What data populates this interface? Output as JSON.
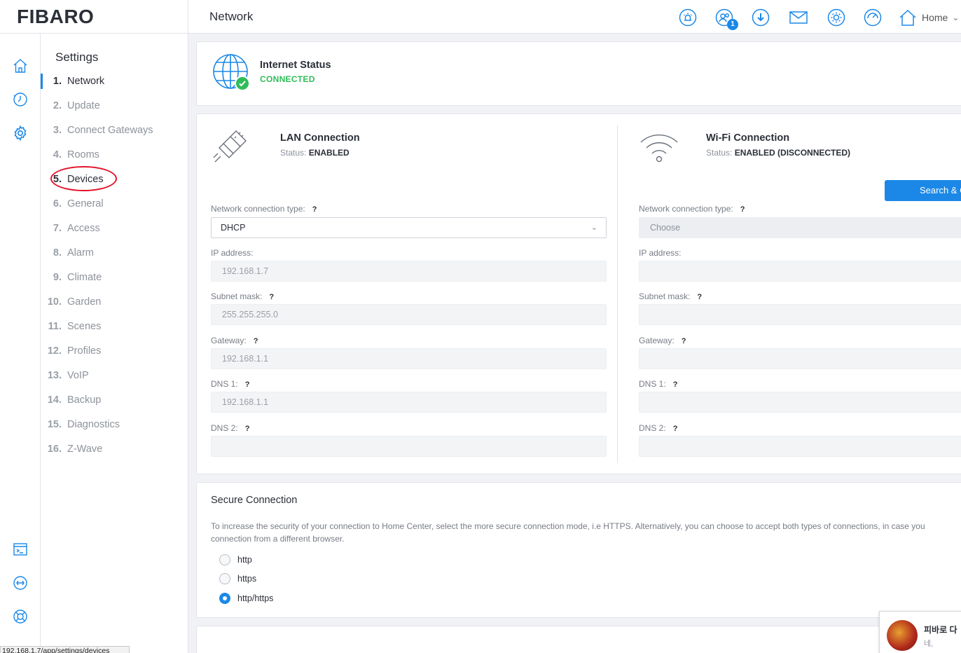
{
  "app": {
    "logo": "FIBARO",
    "page_title": "Network"
  },
  "topbar": {
    "icons": [
      "alarm-icon",
      "users-icon",
      "download-icon",
      "mail-icon",
      "sun-icon",
      "dashboard-icon",
      "home-icon"
    ],
    "users_badge": "1",
    "home_label": "Home",
    "home_chevron": "⌄"
  },
  "rail": {
    "icons": [
      "home-icon",
      "history-icon",
      "settings-icon",
      "terminal-icon",
      "plugin-icon",
      "support-icon"
    ]
  },
  "settings": {
    "title": "Settings",
    "items": [
      {
        "num": "1.",
        "label": "Network"
      },
      {
        "num": "2.",
        "label": "Update"
      },
      {
        "num": "3.",
        "label": "Connect Gateways"
      },
      {
        "num": "4.",
        "label": "Rooms"
      },
      {
        "num": "5.",
        "label": "Devices"
      },
      {
        "num": "6.",
        "label": "General"
      },
      {
        "num": "7.",
        "label": "Access"
      },
      {
        "num": "8.",
        "label": "Alarm"
      },
      {
        "num": "9.",
        "label": "Climate"
      },
      {
        "num": "10.",
        "label": "Garden"
      },
      {
        "num": "11.",
        "label": "Scenes"
      },
      {
        "num": "12.",
        "label": "Profiles"
      },
      {
        "num": "13.",
        "label": "VoIP"
      },
      {
        "num": "14.",
        "label": "Backup"
      },
      {
        "num": "15.",
        "label": "Diagnostics"
      },
      {
        "num": "16.",
        "label": "Z-Wave"
      }
    ],
    "active_index": 0,
    "highlighted_index": 4
  },
  "internet": {
    "title": "Internet Status",
    "status": "CONNECTED"
  },
  "lan": {
    "title": "LAN Connection",
    "status_label": "Status:",
    "status_value": "ENABLED",
    "type_label": "Network connection type:",
    "type_value": "DHCP",
    "ip_label": "IP address:",
    "ip_value": "192.168.1.7",
    "subnet_label": "Subnet mask:",
    "subnet_value": "255.255.255.0",
    "gateway_label": "Gateway:",
    "gateway_value": "192.168.1.1",
    "dns1_label": "DNS 1:",
    "dns1_value": "192.168.1.1",
    "dns2_label": "DNS 2:",
    "dns2_value": ""
  },
  "wifi": {
    "title": "Wi-Fi Connection",
    "status_label": "Status:",
    "status_value": "ENABLED (DISCONNECTED)",
    "search_button": "Search & C",
    "type_label": "Network connection type:",
    "type_value": "Choose",
    "ip_label": "IP address:",
    "subnet_label": "Subnet mask:",
    "gateway_label": "Gateway:",
    "dns1_label": "DNS 1:",
    "dns2_label": "DNS 2:"
  },
  "help_mark": "?",
  "secure": {
    "title": "Secure Connection",
    "description": "To increase the security of your connection to Home Center, select the more secure connection mode, i.e HTTPS. Alternatively, you can choose to accept both types of connections, in case you connection from a different browser.",
    "options": [
      "http",
      "https",
      "http/https"
    ],
    "selected": "http/https"
  },
  "chat": {
    "name": "피바로 다",
    "message": "네,"
  },
  "status_bar": "192.168.1.7/app/settings/devices",
  "colors": {
    "accent": "#1b88e8",
    "success": "#2ebd59",
    "highlight": "#e3132c"
  }
}
